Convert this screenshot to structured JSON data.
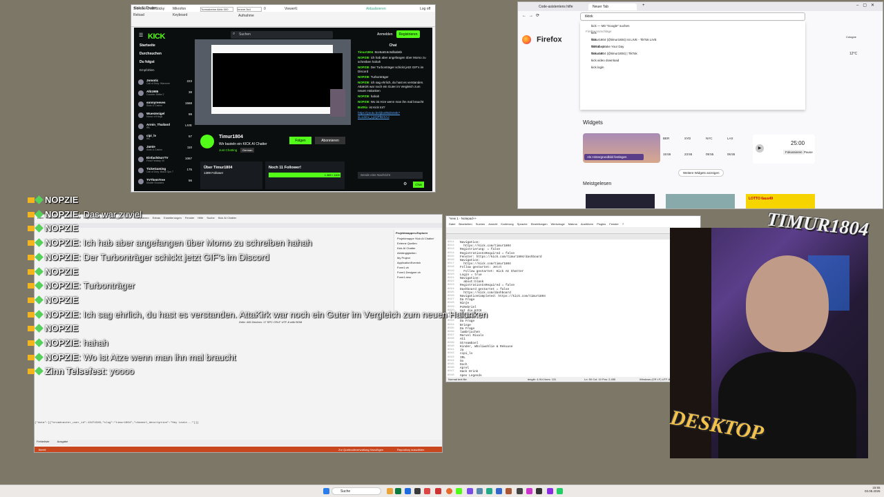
{
  "kick_window": {
    "title": "Kick AI Chatter",
    "controls": [
      "Sidebar/Chatt/Sticky",
      "Reload",
      "Mikrofon",
      "Keyboard",
      "Aufnahme",
      "Aktualisieren",
      "Log off"
    ],
    "url_fields": [
      "Turnusbeine Aktiv 000",
      "Innere 5x4",
      "0",
      "Viewer6:"
    ],
    "site": {
      "logo": "KICK",
      "search_placeholder": "Suchen",
      "login": "Anmelden",
      "register": "Registrieren",
      "nav": [
        "Startseite",
        "Durchsuchen",
        "Du folgst"
      ],
      "recommended_label": "Empfohlen",
      "channels": [
        {
          "name": "Jomotic",
          "game": "Call of Duty: Warzone",
          "count": "223"
        },
        {
          "name": "Alb1985",
          "game": "Counter-Strike 2",
          "count": "38"
        },
        {
          "name": "sonnyreeves",
          "game": "Slots & Casino",
          "count": "1568"
        },
        {
          "name": "Wuestenigel",
          "game": "Honor of Kings",
          "count": "99"
        },
        {
          "name": "Armin_Thailand",
          "game": "IRL",
          "count": "LIVE"
        },
        {
          "name": "cipi_lv",
          "game": "IRL",
          "count": "57"
        },
        {
          "name": "Jamie",
          "game": "Slots & Casino",
          "count": "110"
        },
        {
          "name": "EinfachDurrTV",
          "game": "Final Fantasy VII",
          "count": "1067"
        },
        {
          "name": "TickeGaming",
          "game": "Call of Duty: Black Ops 7",
          "count": "175"
        },
        {
          "name": "TVThemTree",
          "game": "Mobile Shooters",
          "count": "56"
        }
      ],
      "chat_header": "Chat",
      "streamer": "Timur1804",
      "stream_title": "Wir basteln ein KICK AI Chatter",
      "category": "Just Chatting",
      "language": "German",
      "follow": "Folgen",
      "subscribe": "Abonnieren",
      "about": "Über Timur1804",
      "followers": "1389 Follower",
      "goal_label": "Noch 11 Follower!",
      "goal_value": "1.389 / 1400",
      "chat_input": "Sende eine Nachricht",
      "chat_send": "Chat",
      "chat_lines": [
        {
          "user": "Timur1804",
          "text": "8ce5a816c6dbab6b"
        },
        {
          "user": "NOPZIE",
          "text": "ich hab aber angefangen über Momo zu schreiben hahah"
        },
        {
          "user": "NOPZIE",
          "text": "Der Turbonträger schickt jetzt GIF's im Discord"
        },
        {
          "user": "NOPZIE",
          "text": "Turbonträger"
        },
        {
          "user": "NOPZIE",
          "text": "ich sag ehrlich, du hast es verstanden. AttaKirk war noch ein Guter im Vergleich zum neuen Halunken"
        },
        {
          "user": "NOPZIE",
          "text": "hahah"
        },
        {
          "user": "NOPZIE",
          "text": "Wo ist Atze wenn man ihn mal braucht"
        },
        {
          "user": "BotRix",
          "text": "ist Kick tot?"
        }
      ],
      "link": "https://youtu.be/ijbo0l6dm84k?si=L6mv_LjvQPfBrXAJ"
    }
  },
  "firefox": {
    "tabs": [
      "Code-asistentens hilfe",
      "Neuer Tab"
    ],
    "url_value": "tiktok",
    "suggestions": [
      "kick — Mit \"Google\" suchen",
      "kick",
      "kick",
      "kick.shop",
      "kick.com",
      "kick.video download",
      "kick.login"
    ],
    "history_label": "Firefox-Vorschläge",
    "history": [
      "Timur1804 (@timur1804) ist LIVE - TikTok LIVE",
      "TikTok - Make Your Day",
      "Timur1804 (@timur1804) | TikTok"
    ],
    "brand": "Firefox",
    "widgets_label": "Widgets",
    "wallpaper_button": "Als Hintergrundbild festlegen",
    "clocks": [
      {
        "city": "BER",
        "time": "15:55"
      },
      {
        "city": "SYD",
        "time": "23:55"
      },
      {
        "city": "NYC",
        "time": "09:55"
      },
      {
        "city": "LAX",
        "time": "06:55"
      }
    ],
    "timer": "25:00",
    "focus": "Fokussieren",
    "pause": "Pause",
    "more_widgets": "Weitere Widgets anzeigen",
    "top_label": "Meistgelesen",
    "weather_city": "Cologne",
    "weather_temp": "12°C",
    "lotto": "LOTTO 6aus49"
  },
  "overlay": [
    {
      "user": "NOPZIE",
      "text": ""
    },
    {
      "user": "NOPZIE",
      "text": "Das war zuviel"
    },
    {
      "user": "NOPZIE",
      "text": ""
    },
    {
      "user": "NOPZIE",
      "text": "Ich hab aber angefangen über Momo zu schreiben hahah"
    },
    {
      "user": "NOPZIE",
      "text": "Der Turbonträger schickt jetzt GIF's im Discord"
    },
    {
      "user": "NOPZIE",
      "text": ""
    },
    {
      "user": "NOPZIE",
      "text": "Turbonträger"
    },
    {
      "user": "NOPZIE",
      "text": ""
    },
    {
      "user": "NOPZIE",
      "text": "Ich sag ehrlich, du hast es verstanden. AttaKirk war noch ein Guter im Vergleich zum neuen Halunken"
    },
    {
      "user": "NOPZIE",
      "text": ""
    },
    {
      "user": "NOPZIE",
      "text": "hahah"
    },
    {
      "user": "NOPZIE",
      "text": "Wo ist Atze wenn man ihn mal braucht"
    },
    {
      "user": "Zinn Telsefest",
      "text": "yoooo"
    }
  ],
  "vs": {
    "menu": [
      "Datei",
      "Bearbeiten",
      "Ansicht",
      "Git",
      "Projekt",
      "Erstellen",
      "Debuggen",
      "Test",
      "Analysieren",
      "Extras",
      "Erweiterungen",
      "Fenster",
      "Hilfe",
      "Suche",
      "Kick AI Chatter"
    ],
    "explorer_title": "Projektmappen-Explorer",
    "tree": [
      "Projektmappe 'Kick AI Chatter'",
      "Externe Quellen",
      "Kick AI Chatter",
      "Abhängigkeiten",
      "My Project",
      "ApplicationEventsh",
      "Form1.vb",
      "Form1.Designer.vb",
      "Form1.resx"
    ],
    "output_tabs": [
      "Fehlerliste",
      "Ausgabe"
    ],
    "status": "Bereit",
    "status_right": [
      "Zur Quellcodeverwaltung hinzufügen",
      "Repository auswählen"
    ],
    "position": "Zeile: 445  Zeichen: 17  SPC  CRLF  UTF-8 with BOM",
    "ready": "Bereit"
  },
  "notepad": {
    "title": "*new 1 - Notepad++",
    "menu": [
      "Datei",
      "Bearbeiten",
      "Suchen",
      "Ansicht",
      "Kodierung",
      "Sprache",
      "Einstellungen",
      "Werkzeuge",
      "Makros",
      "Ausführen",
      "Plugins",
      "Fenster",
      "?"
    ],
    "lines": [
      "Navigation:",
      "  https://kick.com/timur1804",
      "Registrierung: = false",
      "RegistrationIsRequired = false",
      "Fenster: https://kick.com/timur1804/dashboard",
      "",
      "Navigation:",
      "  https://kick.com/timur1804",
      "Follow gestartet: Jetzt",
      "  Follow gestartet: Kick AI Chatter",
      "Login = true",
      "",
      "Navigation:",
      "  about:blank",
      "RegistrationIsRequired = false",
      "Dashboard gestartet = false",
      "  https://kick.com/dashboard",
      "NavigationCompleted: https://kick.com/timur1804",
      "",
      "",
      "Da Frage",
      "Ninje",
      "PcRebriel",
      "Hut die KICK",
      "DoubleTime",
      "Streamer",
      "",
      "Da Frage",
      "Bringe",
      "Da Frage",
      "lumbriuchen",
      "Marvel Rivals",
      "Ati",
      "Streamboel",
      "Kinder, Wholiwohlie & Rekuuse",
      "Ja",
      "cipi_lv",
      "IRL",
      "So",
      "Doch",
      "Aprel",
      "Hack Drink",
      "Apex Legends",
      "Drive"
    ],
    "status": "Normal text file",
    "status_mid": "length: 4,914  lines: 131",
    "status_pos": "Ln: 50  Col: 10  Pos: 2,455",
    "status_enc": "Windows (CR LF)  UTF-8  INS"
  },
  "cam": {
    "title_text": "TIMUR1804",
    "desktop_text": "DESKTOP"
  },
  "taskbar": {
    "search": "Suche",
    "time": "15:55",
    "date": "03.08.2026"
  }
}
